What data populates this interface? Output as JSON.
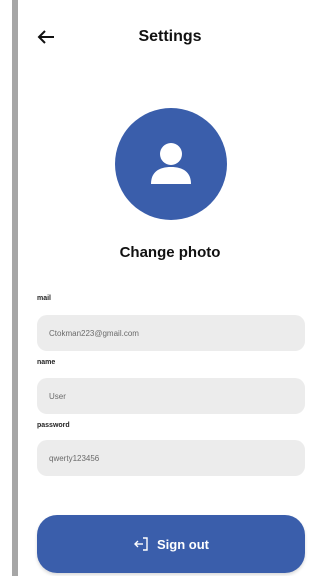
{
  "header": {
    "back_icon": "arrow-left-icon",
    "title": "Settings"
  },
  "profile": {
    "avatar_icon": "user-icon",
    "change_photo_label": "Change photo"
  },
  "form": {
    "mail": {
      "label": "mail",
      "value": "Ctokman223@gmail.com"
    },
    "name": {
      "label": "name",
      "value": "User"
    },
    "password": {
      "label": "password",
      "value": "qwerty123456"
    }
  },
  "actions": {
    "signout_label": "Sign out",
    "signout_icon": "sign-out-icon"
  },
  "colors": {
    "accent": "#3a5eab",
    "field_background": "#ececec",
    "side_bar": "#a6a6a6"
  }
}
